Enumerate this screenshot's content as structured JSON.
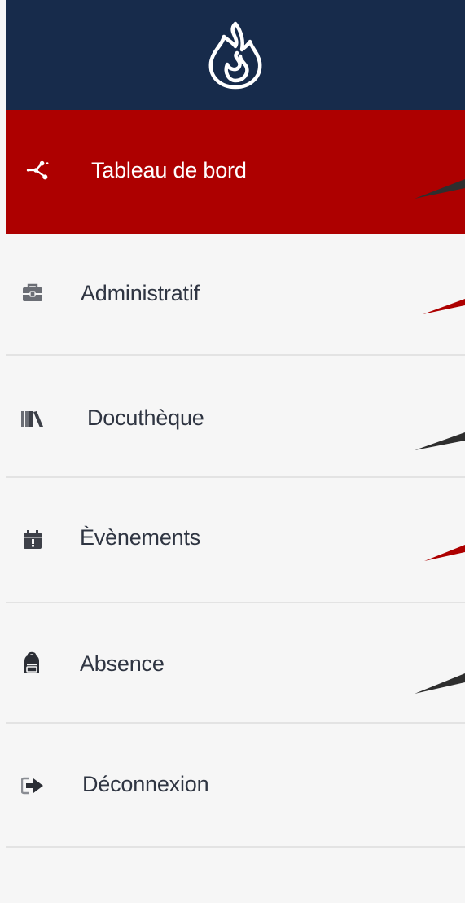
{
  "brand": {
    "logo_icon": "flame-icon",
    "background_color": "#172b4b"
  },
  "colors": {
    "active_background": "#ad0000",
    "active_text": "#ffffff",
    "item_text": "#2f3542",
    "item_background": "#f6f6f6",
    "divider": "#e3e3e3"
  },
  "menu": {
    "items": [
      {
        "label": "Tableau de bord",
        "icon": "network-nodes-icon",
        "active": true
      },
      {
        "label": "Administratif",
        "icon": "briefcase-icon",
        "active": false
      },
      {
        "label": "Docuthèque",
        "icon": "books-icon",
        "active": false
      },
      {
        "label": "Èvènements",
        "icon": "calendar-icon",
        "active": false
      },
      {
        "label": "Absence",
        "icon": "backpack-icon",
        "active": false
      },
      {
        "label": "Déconnexion",
        "icon": "sign-out-icon",
        "active": false
      }
    ]
  }
}
